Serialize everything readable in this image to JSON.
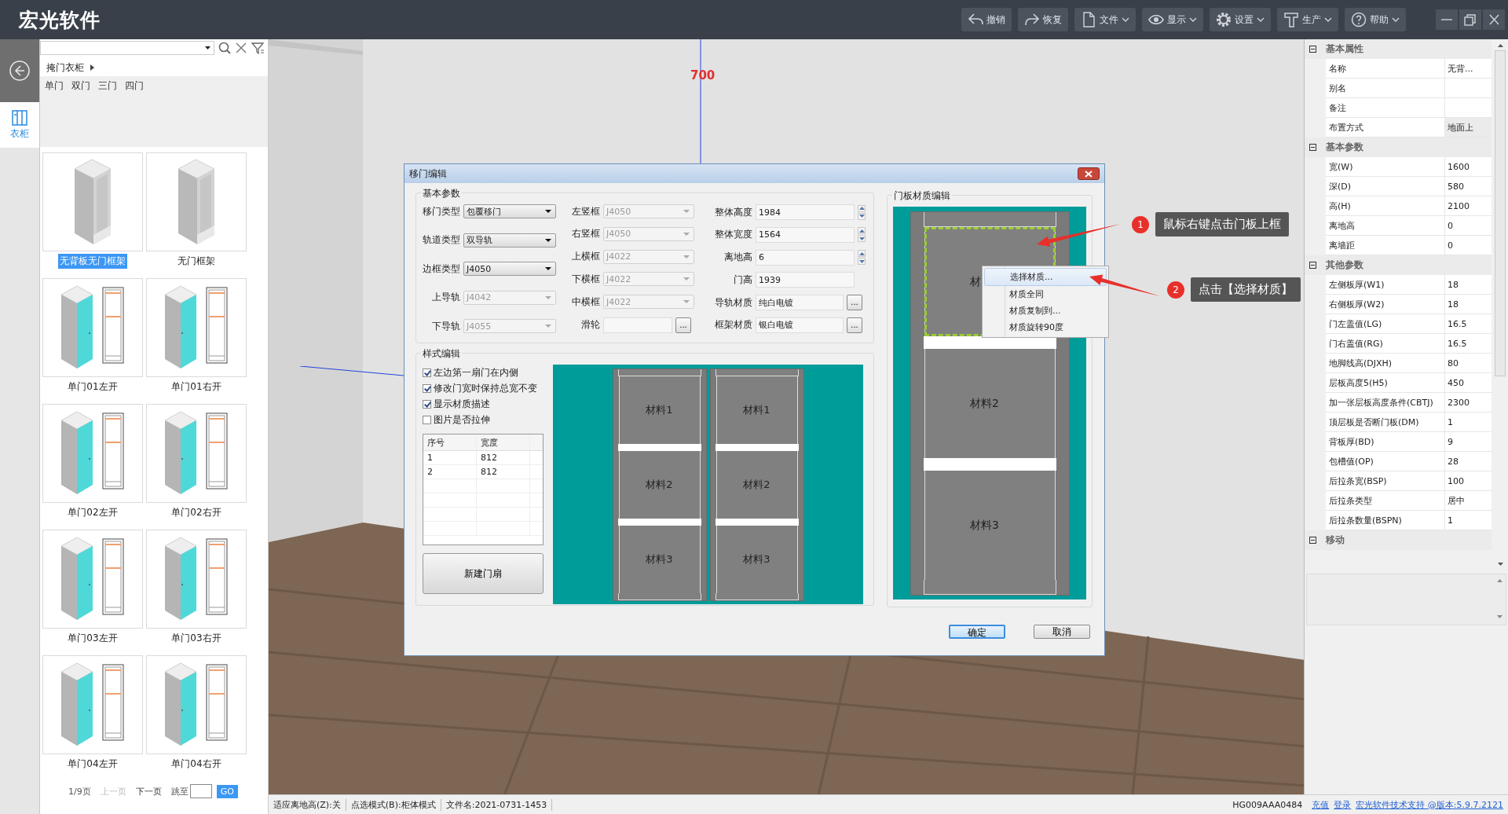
{
  "app": {
    "title": "宏光软件"
  },
  "toolbar": [
    {
      "kind": "undo",
      "label": "撤销",
      "menu": false
    },
    {
      "kind": "redo",
      "label": "恢复",
      "menu": false
    },
    {
      "kind": "file",
      "label": "文件",
      "menu": true
    },
    {
      "kind": "view",
      "label": "显示",
      "menu": true
    },
    {
      "kind": "settings",
      "label": "设置",
      "menu": true
    },
    {
      "kind": "produce",
      "label": "生产",
      "menu": true
    },
    {
      "kind": "help",
      "label": "帮助",
      "menu": true
    }
  ],
  "side_tabs": [
    {
      "label": "衣柜",
      "selected": true
    }
  ],
  "library": {
    "breadcrumb": "掩门衣柜",
    "categories": [
      {
        "label": "单门",
        "selected": false
      },
      {
        "label": "双门",
        "selected": false
      },
      {
        "label": "三门",
        "selected": false
      },
      {
        "label": "四门",
        "selected": false
      }
    ],
    "items": [
      {
        "label": "无背板无门框架",
        "kind": "frame",
        "selected": true
      },
      {
        "label": "无门框架",
        "kind": "frame",
        "selected": false
      },
      {
        "label": "单门01左开",
        "kind": "door-left",
        "selected": false
      },
      {
        "label": "单门01右开",
        "kind": "door-right",
        "selected": false
      },
      {
        "label": "单门02左开",
        "kind": "door-left",
        "selected": false
      },
      {
        "label": "单门02右开",
        "kind": "door-right",
        "selected": false
      },
      {
        "label": "单门03左开",
        "kind": "door-left",
        "selected": false
      },
      {
        "label": "单门03右开",
        "kind": "door-right",
        "selected": false
      },
      {
        "label": "单门04左开",
        "kind": "door-left",
        "selected": false
      },
      {
        "label": "单门04右开",
        "kind": "door-right",
        "selected": false
      }
    ],
    "pagination": {
      "page": "1/9页",
      "prev": "上一页",
      "prev_disabled": true,
      "next": "下一页",
      "jump_label": "跳至",
      "go": "GO"
    }
  },
  "viewport": {
    "dimension": "700"
  },
  "dialog": {
    "title": "移门编辑",
    "basic": {
      "title": "基本参数",
      "columns": [
        [
          {
            "label": "移门类型",
            "value": "包覆移门",
            "kind": "combo",
            "disabled": false
          },
          {
            "label": "轨道类型",
            "value": "双导轨",
            "kind": "combo",
            "disabled": false
          },
          {
            "label": "边框类型",
            "value": "J4050",
            "kind": "combo",
            "disabled": false
          },
          {
            "label": "上导轨",
            "value": "J4042",
            "kind": "combo",
            "disabled": true
          },
          {
            "label": "下导轨",
            "value": "J4055",
            "kind": "combo",
            "disabled": true
          }
        ],
        [
          {
            "label": "左竖框",
            "value": "J4050",
            "kind": "combo",
            "disabled": true
          },
          {
            "label": "右竖框",
            "value": "J4050",
            "kind": "combo",
            "disabled": true
          },
          {
            "label": "上横框",
            "value": "J4022",
            "kind": "combo",
            "disabled": true
          },
          {
            "label": "下横框",
            "value": "J4022",
            "kind": "combo",
            "disabled": true
          },
          {
            "label": "中横框",
            "value": "J4022",
            "kind": "combo",
            "disabled": true
          },
          {
            "label": "滑轮",
            "kind": "browse",
            "button": "..."
          }
        ],
        [
          {
            "label": "整体高度",
            "value": "1984",
            "kind": "spin"
          },
          {
            "label": "整体宽度",
            "value": "1564",
            "kind": "spin"
          },
          {
            "label": "离地高",
            "value": "6",
            "kind": "spin"
          },
          {
            "label": "门高",
            "value": "1939",
            "kind": "text"
          },
          {
            "label": "导轨材质",
            "value": "纯白电镀",
            "kind": "browse",
            "button": "..."
          },
          {
            "label": "框架材质",
            "value": "银白电镀",
            "kind": "browse",
            "button": "..."
          }
        ]
      ]
    },
    "style": {
      "title": "样式编辑",
      "options": [
        {
          "label": "左边第一扇门在内侧",
          "checked": true
        },
        {
          "label": "修改门宽时保持总宽不变",
          "checked": true
        },
        {
          "label": "显示材质描述",
          "checked": true
        },
        {
          "label": "图片是否拉伸",
          "checked": false
        }
      ],
      "table": {
        "columns": [
          "序号",
          "宽度"
        ],
        "rows": [
          [
            "1",
            "812"
          ],
          [
            "2",
            "812"
          ]
        ]
      },
      "new_button": "新建门扇",
      "doors": [
        {
          "panels": [
            "材料1",
            "材料2",
            "材料3"
          ]
        },
        {
          "panels": [
            "材料1",
            "材料2",
            "材料3"
          ]
        }
      ]
    },
    "material": {
      "title": "门板材质编辑",
      "panels": [
        {
          "label": "材",
          "selected": true
        },
        {
          "label": "材料2",
          "selected": false
        },
        {
          "label": "材料3",
          "selected": false
        }
      ]
    },
    "buttons": [
      {
        "label": "确定",
        "default": true
      },
      {
        "label": "取消",
        "default": false
      }
    ]
  },
  "context_menu": [
    {
      "label": "选择材质...",
      "selected": true
    },
    {
      "label": "材质全同",
      "selected": false
    },
    {
      "label": "材质复制到...",
      "selected": false
    },
    {
      "label": "材质旋转90度",
      "selected": false
    }
  ],
  "annotations": [
    {
      "number": "1",
      "text": "鼠标右键点击门板上框"
    },
    {
      "number": "2",
      "text": "点击【选择材质】"
    }
  ],
  "properties": [
    {
      "title": "基本属性",
      "expanded": true,
      "rows": [
        {
          "name": "名称",
          "value": "无背...",
          "selected": false
        },
        {
          "name": "别名",
          "selected": false
        },
        {
          "name": "备注",
          "selected": false
        },
        {
          "name": "布置方式",
          "value": "地面上",
          "selected": true
        }
      ]
    },
    {
      "title": "基本参数",
      "expanded": true,
      "rows": [
        {
          "name": "宽(W)",
          "value": "1600",
          "selected": false
        },
        {
          "name": "深(D)",
          "value": "580",
          "selected": false
        },
        {
          "name": "高(H)",
          "value": "2100",
          "selected": false
        },
        {
          "name": "离地高",
          "value": "0",
          "selected": false
        },
        {
          "name": "离墙距",
          "value": "0",
          "selected": false
        }
      ]
    },
    {
      "title": "其他参数",
      "expanded": true,
      "rows": [
        {
          "name": "左侧板厚(W1)",
          "value": "18",
          "selected": false
        },
        {
          "name": "右侧板厚(W2)",
          "value": "18",
          "selected": false
        },
        {
          "name": "门左盖值(LG)",
          "value": "16.5",
          "selected": false
        },
        {
          "name": "门右盖值(RG)",
          "value": "16.5",
          "selected": false
        },
        {
          "name": "地脚线高(DJXH)",
          "value": "80",
          "selected": false
        },
        {
          "name": "层板高度5(H5)",
          "value": "450",
          "selected": false
        },
        {
          "name": "加一张层板高度条件(CBTJ)",
          "value": "2300",
          "selected": false
        },
        {
          "name": "顶层板是否断门板(DM)",
          "value": "1",
          "selected": false
        },
        {
          "name": "背板厚(BD)",
          "value": "9",
          "selected": false
        },
        {
          "name": "包槽值(OP)",
          "value": "28",
          "selected": false
        },
        {
          "name": "后拉条宽(BSP)",
          "value": "100",
          "selected": false
        },
        {
          "name": "后拉条类型",
          "value": "居中",
          "selected": false
        },
        {
          "name": "后拉条数量(BSPN)",
          "value": "1",
          "selected": false
        }
      ]
    },
    {
      "title": "移动",
      "expanded": true
    }
  ],
  "status_bar": {
    "items": [
      "适应离地高(Z):关",
      "点选模式(B):柜体模式",
      "文件名:2021-0731-1453"
    ],
    "code": "HG009AAA0484",
    "links": [
      "充值",
      "登录",
      "宏光软件技术支持 @版本:5.9.7.2121"
    ]
  }
}
